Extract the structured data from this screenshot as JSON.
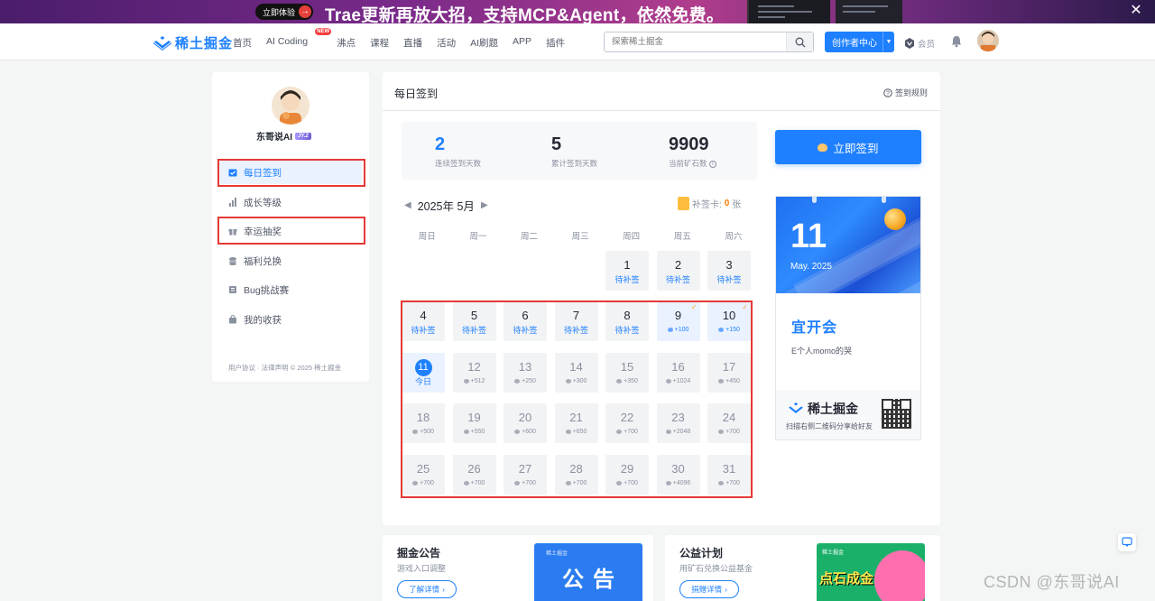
{
  "banner": {
    "cta": "立即体验",
    "headline": "Trae更新再放大招，支持MCP&Agent，依然免费。",
    "close": "✕"
  },
  "header": {
    "logo": "稀土掘金",
    "nav": [
      "首页",
      "AI Coding",
      "沸点",
      "课程",
      "直播",
      "活动",
      "AI刷题",
      "APP",
      "插件"
    ],
    "nav_new_badge": "NEW",
    "search_placeholder": "探索稀土掘金",
    "creator_button": "创作者中心",
    "vip_label": "会员"
  },
  "sidebar": {
    "user_name": "东哥说AI",
    "level_badge": "JY.2",
    "items": [
      {
        "label": "每日签到",
        "icon": "calendar-check-icon",
        "active": true
      },
      {
        "label": "成长等级",
        "icon": "bar-chart-icon",
        "active": false
      },
      {
        "label": "幸运抽奖",
        "icon": "gift-icon",
        "active": false
      },
      {
        "label": "福利兑换",
        "icon": "coins-stack-icon",
        "active": false
      },
      {
        "label": "Bug挑战赛",
        "icon": "bug-icon",
        "active": false
      },
      {
        "label": "我的收获",
        "icon": "bag-icon",
        "active": false
      }
    ],
    "footer": "用户协议 · 法律声明 © 2025 稀土掘金"
  },
  "main": {
    "title": "每日签到",
    "rules": "签到规则",
    "stats": [
      {
        "value": "2",
        "label": "连续签到天数"
      },
      {
        "value": "5",
        "label": "累计签到天数"
      },
      {
        "value": "9909",
        "label": "当前矿石数"
      }
    ],
    "month": "2025年 5月",
    "supplement_label": "补签卡:",
    "supplement_count": "0",
    "supplement_unit": "张",
    "weekdays": [
      "周日",
      "周一",
      "周二",
      "周三",
      "周四",
      "周五",
      "周六"
    ],
    "days": [
      {
        "d": "1",
        "s": "待补签",
        "kind": "pending"
      },
      {
        "d": "2",
        "s": "待补签",
        "kind": "pending"
      },
      {
        "d": "3",
        "s": "待补签",
        "kind": "pending"
      },
      {
        "d": "4",
        "s": "待补签",
        "kind": "pending"
      },
      {
        "d": "5",
        "s": "待补签",
        "kind": "pending"
      },
      {
        "d": "6",
        "s": "待补签",
        "kind": "pending"
      },
      {
        "d": "7",
        "s": "待补签",
        "kind": "pending"
      },
      {
        "d": "8",
        "s": "待补签",
        "kind": "pending"
      },
      {
        "d": "9",
        "s": "+100",
        "kind": "signed"
      },
      {
        "d": "10",
        "s": "+150",
        "kind": "signed"
      },
      {
        "d": "11",
        "s": "今日",
        "kind": "today"
      },
      {
        "d": "12",
        "s": "+512",
        "kind": "future"
      },
      {
        "d": "13",
        "s": "+250",
        "kind": "future"
      },
      {
        "d": "14",
        "s": "+300",
        "kind": "future"
      },
      {
        "d": "15",
        "s": "+350",
        "kind": "future"
      },
      {
        "d": "16",
        "s": "+1024",
        "kind": "future"
      },
      {
        "d": "17",
        "s": "+450",
        "kind": "future"
      },
      {
        "d": "18",
        "s": "+500",
        "kind": "future"
      },
      {
        "d": "19",
        "s": "+550",
        "kind": "future"
      },
      {
        "d": "20",
        "s": "+600",
        "kind": "future"
      },
      {
        "d": "21",
        "s": "+650",
        "kind": "future"
      },
      {
        "d": "22",
        "s": "+700",
        "kind": "future"
      },
      {
        "d": "23",
        "s": "+2048",
        "kind": "future"
      },
      {
        "d": "24",
        "s": "+700",
        "kind": "future"
      },
      {
        "d": "25",
        "s": "+700",
        "kind": "future"
      },
      {
        "d": "26",
        "s": "+700",
        "kind": "future"
      },
      {
        "d": "27",
        "s": "+700",
        "kind": "future"
      },
      {
        "d": "28",
        "s": "+700",
        "kind": "future"
      },
      {
        "d": "29",
        "s": "+700",
        "kind": "future"
      },
      {
        "d": "30",
        "s": "+4096",
        "kind": "future"
      },
      {
        "d": "31",
        "s": "+700",
        "kind": "future"
      }
    ],
    "month_start_weekday": 4,
    "sign_button": "立即签到",
    "poster": {
      "day": "11",
      "month_year": "May. 2025",
      "almanac": "宜开会",
      "quote": "E个人momo的哭",
      "brand": "稀土掘金",
      "qr_text": "扫描右侧二维码分享给好友"
    }
  },
  "bottom": {
    "notice": {
      "title": "掘金公告",
      "subtitle": "游戏入口调整",
      "more": "了解详情",
      "img_small": "稀土掘金",
      "img_big": "公告"
    },
    "charity": {
      "title": "公益计划",
      "subtitle": "用矿石兑换公益基金",
      "more": "捐赠详情",
      "img_small": "稀土掘金",
      "img_big": "点石成金"
    }
  },
  "watermark": "CSDN @东哥说AI",
  "colors": {
    "brand": "#1e80ff",
    "highlight_box": "#e53935"
  }
}
